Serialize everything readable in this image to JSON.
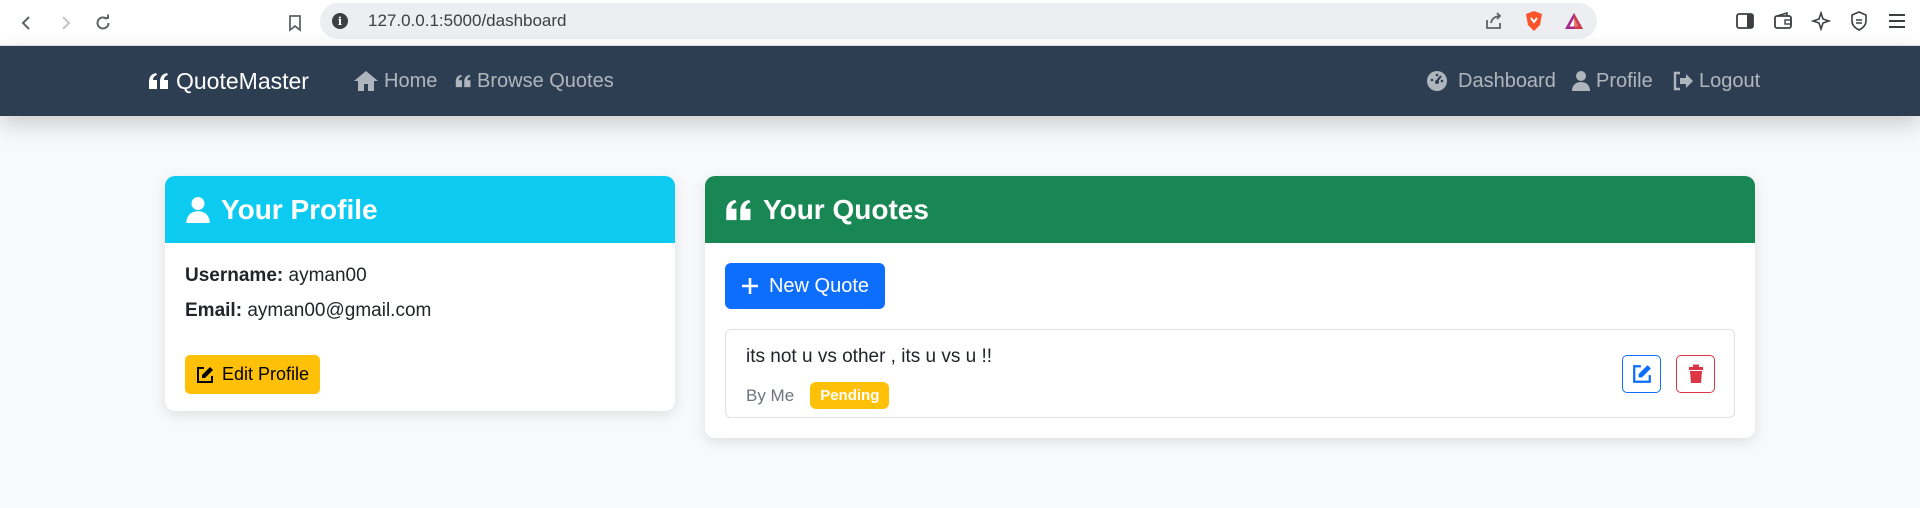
{
  "browser": {
    "url": "127.0.0.1:5000/dashboard"
  },
  "navbar": {
    "brand": "QuoteMaster",
    "links": {
      "home": "Home",
      "browse": "Browse Quotes",
      "dashboard": "Dashboard",
      "profile": "Profile",
      "logout": "Logout"
    }
  },
  "profile_card": {
    "title": "Your Profile",
    "username_label": "Username:",
    "username": "ayman00",
    "email_label": "Email:",
    "email": "ayman00@gmail.com",
    "edit_button": "Edit Profile"
  },
  "quotes_card": {
    "title": "Your Quotes",
    "new_button": "New Quote",
    "quotes": [
      {
        "text": "its not u vs other , its u vs u !!",
        "author": "By Me",
        "status": "Pending"
      }
    ]
  },
  "colors": {
    "navbar": "#2e3e52",
    "profile_header": "#0dcaf0",
    "quotes_header": "#198754",
    "primary": "#0d6efd",
    "warning": "#ffc107",
    "danger": "#dc3545"
  }
}
